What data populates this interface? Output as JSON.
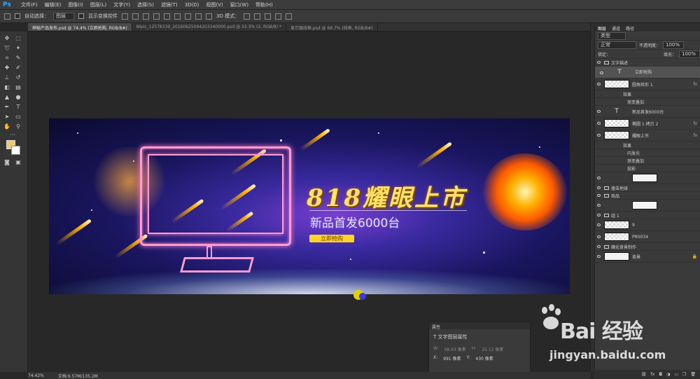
{
  "app": {
    "logo": "Ps"
  },
  "menu": [
    "文件(F)",
    "编辑(E)",
    "图像(I)",
    "图层(L)",
    "文字(Y)",
    "选择(S)",
    "滤镜(T)",
    "3D(D)",
    "视图(V)",
    "窗口(W)",
    "帮助(H)"
  ],
  "options": {
    "auto_select_label": "自动选择：",
    "auto_select_value": "图层",
    "show_transform_label": "显示变换控件",
    "mode_3d_label": "3D 模式："
  },
  "tabs": [
    {
      "label": "神秘产品发布.psd @ 74.4% (立即抢购, RGB/8#)",
      "active": true
    },
    {
      "label": "Nipic_12578339_20160625094203340000.psd @ 33.3% (2, RGB/8) *",
      "active": false
    },
    {
      "label": "显示器线框.psd @ 66.7% (线框, RGB/8#)",
      "active": false
    }
  ],
  "banner": {
    "headline": "818耀眼上市",
    "subline": "新品首发6000台",
    "cta": "立即抢购"
  },
  "layers_panel": {
    "tabs": [
      "图层",
      "通道",
      "路径"
    ],
    "filter_label": "类型",
    "blend": "正常",
    "opacity_label": "不透明度：",
    "opacity": "100%",
    "lock_label": "锁定：",
    "fill_label": "填充：",
    "fill": "100%",
    "rows": [
      {
        "name": "文字描述",
        "kind": "group"
      },
      {
        "name": "立即抢购",
        "kind": "text",
        "selected": true
      },
      {
        "name": "圆角矩形 1",
        "kind": "shape",
        "fx": "fx"
      },
      {
        "name": "效果",
        "kind": "effect"
      },
      {
        "name": "渐变叠加",
        "kind": "effect"
      },
      {
        "name": "新品首发6000台",
        "kind": "text"
      },
      {
        "name": "椭圆 1 拷贝 2",
        "kind": "shape",
        "fx": "fx"
      },
      {
        "name": "耀眼上市",
        "kind": "shape",
        "fx": "fx"
      },
      {
        "name": "效果",
        "kind": "effect"
      },
      {
        "name": "内发光",
        "kind": "effect"
      },
      {
        "name": "渐变叠加",
        "kind": "effect"
      },
      {
        "name": "投影",
        "kind": "effect"
      },
      {
        "name": "",
        "kind": "mask"
      },
      {
        "name": "撞击地球",
        "kind": "group"
      },
      {
        "name": "商品",
        "kind": "group"
      },
      {
        "name": "",
        "kind": "mask"
      },
      {
        "name": "组 1",
        "kind": "group"
      },
      {
        "name": "9",
        "kind": "shape"
      },
      {
        "name": "PR0034",
        "kind": "shape"
      },
      {
        "name": "魔化背景制作",
        "kind": "group"
      },
      {
        "name": "背景",
        "kind": "bg"
      }
    ]
  },
  "properties": {
    "title": "属性",
    "subtitle": "文字图层属性",
    "w_label": "W:",
    "w": "98.93 像素",
    "h_label": "H:",
    "h": "25.12 像素",
    "x_label": "X:",
    "x": "991 像素",
    "y_label": "Y:",
    "y": "430 像素"
  },
  "status": {
    "zoom": "74.42%",
    "doc": "文档:9.57M/135.2M"
  },
  "watermark": {
    "brand": "Bai  经验",
    "url": "jingyan.baidu.com"
  }
}
